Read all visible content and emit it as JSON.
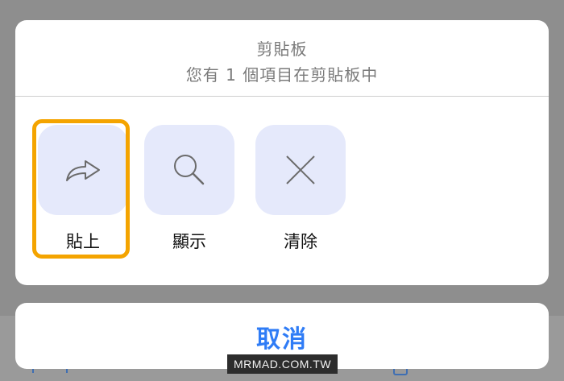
{
  "clipboard_sheet": {
    "title": "剪貼板",
    "subtitle": "您有 1 個項目在剪貼板中",
    "actions": [
      {
        "label": "貼上",
        "icon": "share-arrow-icon",
        "highlighted": true
      },
      {
        "label": "顯示",
        "icon": "magnifier-icon",
        "highlighted": false
      },
      {
        "label": "清除",
        "icon": "close-x-icon",
        "highlighted": false
      }
    ]
  },
  "cancel": {
    "label": "取消"
  },
  "watermark": {
    "text": "MRMAD.COM.TW"
  },
  "colors": {
    "accent": "#2f7cf6",
    "highlight": "#f4a400",
    "tile": "#e5e9fb",
    "backdrop": "#8e8e8e"
  }
}
